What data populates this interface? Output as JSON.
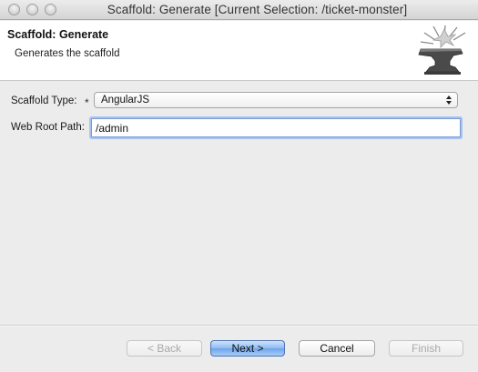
{
  "window": {
    "title": "Scaffold: Generate [Current Selection: /ticket-monster]"
  },
  "banner": {
    "title": "Scaffold: Generate",
    "description": "Generates the scaffold",
    "icon": "anvil-icon"
  },
  "form": {
    "scaffold_type": {
      "label": "Scaffold Type:",
      "required_marker": "*",
      "selected": "AngularJS"
    },
    "web_root_path": {
      "label": "Web Root Path:",
      "value": "/admin"
    }
  },
  "buttons": {
    "back": "< Back",
    "next": "Next >",
    "cancel": "Cancel",
    "finish": "Finish"
  },
  "colors": {
    "default_button": "#8fbaf1",
    "focus_ring": "#a7c4ef",
    "disabled_text": "#a9a9a9"
  }
}
